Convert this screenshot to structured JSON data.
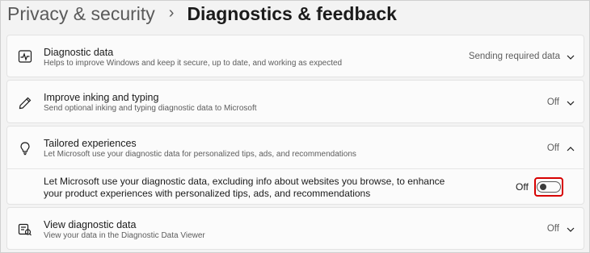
{
  "breadcrumb": {
    "parent": "Privacy & security",
    "separator": "›",
    "current": "Diagnostics & feedback"
  },
  "sections": {
    "diagnostic_data": {
      "title": "Diagnostic data",
      "subtitle": "Helps to improve Windows and keep it secure, up to date, and working as expected",
      "value": "Sending required data",
      "icon": "pulse-chart-icon"
    },
    "inking_typing": {
      "title": "Improve inking and typing",
      "subtitle": "Send optional inking and typing diagnostic data to Microsoft",
      "value": "Off",
      "icon": "pen-icon"
    },
    "tailored": {
      "title": "Tailored experiences",
      "subtitle": "Let Microsoft use your diagnostic data for personalized tips, ads, and recommendations",
      "value": "Off",
      "icon": "lightbulb-icon",
      "expanded": true,
      "setting_text": "Let Microsoft use your diagnostic data, excluding info about websites you browse, to enhance your product experiences with personalized tips, ads, and recommendations",
      "toggle_label": "Off",
      "toggle_on": false
    },
    "view_data": {
      "title": "View diagnostic data",
      "subtitle": "View your data in the Diagnostic Data Viewer",
      "value": "Off",
      "icon": "data-viewer-icon"
    }
  },
  "colors": {
    "highlight": "#d70000",
    "background": "#f3f3f3",
    "card": "#fbfbfb"
  }
}
